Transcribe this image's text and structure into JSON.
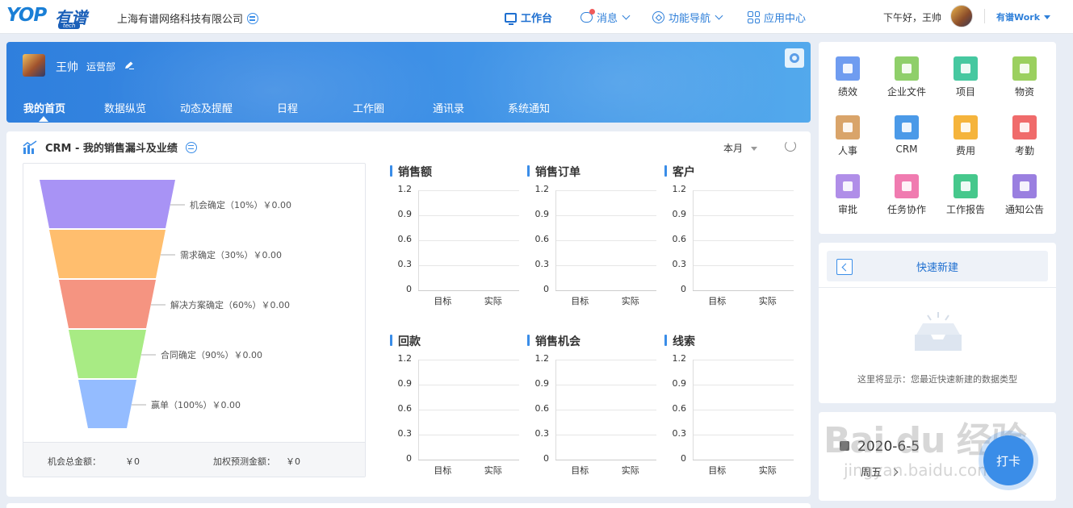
{
  "topbar": {
    "logo_text": "YOP",
    "logo_cn": "有谱",
    "logo_sub": "tech",
    "company": "上海有谱网络科技有限公司",
    "nav": [
      {
        "label": "工作台",
        "icon": "monitor-icon"
      },
      {
        "label": "消息",
        "icon": "chat-icon"
      },
      {
        "label": "功能导航",
        "icon": "compass-icon"
      },
      {
        "label": "应用中心",
        "icon": "grid-icon"
      }
    ],
    "greeting": "下午好，王帅",
    "workspace": "有谱Work"
  },
  "banner": {
    "user_name": "王帅",
    "department": "运营部",
    "tabs": [
      "我的首页",
      "数据纵览",
      "动态及提醒",
      "日程",
      "工作圈",
      "通讯录",
      "系统通知"
    ],
    "active_tab": "我的首页"
  },
  "crm": {
    "title": "CRM - 我的销售漏斗及业绩",
    "period": "本月",
    "funnel": [
      {
        "label": "机会确定（10%）￥0.00",
        "color": "#a893f5"
      },
      {
        "label": "需求确定（30%）￥0.00",
        "color": "#ffbe6e"
      },
      {
        "label": "解决方案确定（60%）￥0.00",
        "color": "#f59481"
      },
      {
        "label": "合同确定（90%）￥0.00",
        "color": "#a8eb84"
      },
      {
        "label": "赢单（100%）￥0.00",
        "color": "#94bcff"
      }
    ],
    "total_label": "机会总金额：",
    "total_value": "￥0",
    "weighted_label": "加权预测金额：",
    "weighted_value": "￥0"
  },
  "chart_data": [
    {
      "type": "bar",
      "title": "销售额",
      "categories": [
        "目标",
        "实际"
      ],
      "values": [
        0,
        0
      ],
      "ylim": [
        0,
        1.2
      ],
      "yticks": [
        "1.2",
        "0.9",
        "0.6",
        "0.3",
        "0"
      ]
    },
    {
      "type": "bar",
      "title": "销售订单",
      "categories": [
        "目标",
        "实际"
      ],
      "values": [
        0,
        0
      ],
      "ylim": [
        0,
        1.2
      ],
      "yticks": [
        "1.2",
        "0.9",
        "0.6",
        "0.3",
        "0"
      ]
    },
    {
      "type": "bar",
      "title": "客户",
      "categories": [
        "目标",
        "实际"
      ],
      "values": [
        0,
        0
      ],
      "ylim": [
        0,
        1.2
      ],
      "yticks": [
        "1.2",
        "0.9",
        "0.6",
        "0.3",
        "0"
      ]
    },
    {
      "type": "bar",
      "title": "回款",
      "categories": [
        "目标",
        "实际"
      ],
      "values": [
        0,
        0
      ],
      "ylim": [
        0,
        1.2
      ],
      "yticks": [
        "1.2",
        "0.9",
        "0.6",
        "0.3",
        "0"
      ]
    },
    {
      "type": "bar",
      "title": "销售机会",
      "categories": [
        "目标",
        "实际"
      ],
      "values": [
        0,
        0
      ],
      "ylim": [
        0,
        1.2
      ],
      "yticks": [
        "1.2",
        "0.9",
        "0.6",
        "0.3",
        "0"
      ]
    },
    {
      "type": "bar",
      "title": "线索",
      "categories": [
        "目标",
        "实际"
      ],
      "values": [
        0,
        0
      ],
      "ylim": [
        0,
        1.2
      ],
      "yticks": [
        "1.2",
        "0.9",
        "0.6",
        "0.3",
        "0"
      ]
    }
  ],
  "apps": [
    {
      "label": "绩效",
      "color": "#6f9cf0",
      "icon": "bar-chart-icon"
    },
    {
      "label": "企业文件",
      "color": "#8fcf6a",
      "icon": "file-icon"
    },
    {
      "label": "项目",
      "color": "#46c8a0",
      "icon": "project-icon"
    },
    {
      "label": "物资",
      "color": "#9bd05f",
      "icon": "box-icon"
    },
    {
      "label": "人事",
      "color": "#d9a46a",
      "icon": "badge-icon"
    },
    {
      "label": "CRM",
      "color": "#4b9ae8",
      "icon": "crm-icon"
    },
    {
      "label": "费用",
      "color": "#f5b43c",
      "icon": "coin-icon"
    },
    {
      "label": "考勤",
      "color": "#f06b6b",
      "icon": "calendar-icon"
    },
    {
      "label": "审批",
      "color": "#b08ee8",
      "icon": "stamp-icon"
    },
    {
      "label": "任务协作",
      "color": "#f07bb0",
      "icon": "task-icon"
    },
    {
      "label": "工作报告",
      "color": "#46c88c",
      "icon": "report-icon"
    },
    {
      "label": "通知公告",
      "color": "#9a7fe0",
      "icon": "speaker-icon"
    }
  ],
  "quick_create": {
    "title": "快速新建",
    "hint": "这里将显示：您最近快速新建的数据类型"
  },
  "attendance": {
    "date": "2020-6-5",
    "weekday": "周五",
    "punch_label": "打卡"
  },
  "watermark": {
    "text": "Bai du 经验",
    "sub": "jingyan.baidu.com"
  }
}
